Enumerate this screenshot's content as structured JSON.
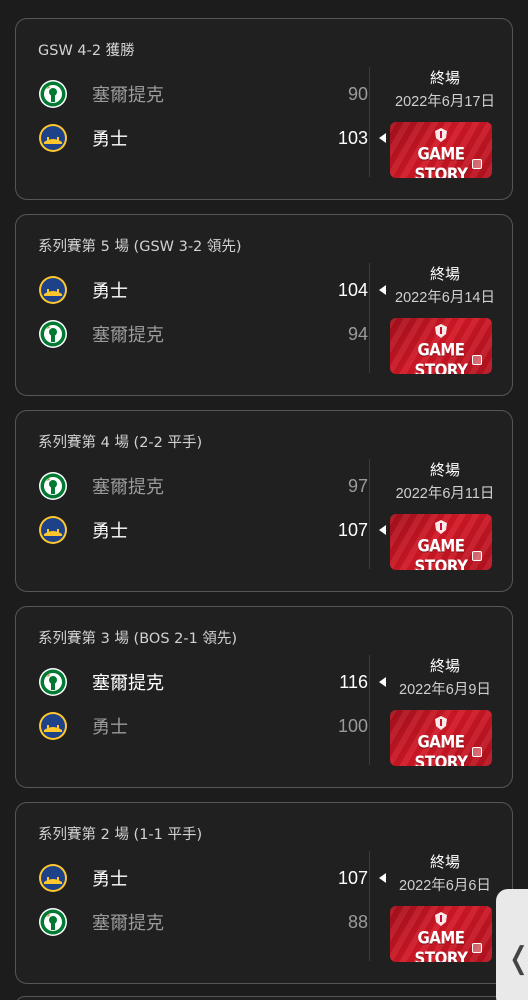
{
  "colors": {
    "background": "#1c1c1c",
    "card_border": "#555555",
    "gamestory_red": "#d41826",
    "warriors_blue": "#1d428a",
    "warriors_gold": "#ffc72c",
    "celtics_green": "#007a33"
  },
  "games": [
    {
      "title": "GSW 4-2 獲勝",
      "status": "終場",
      "date": "2022年6月17日",
      "gamestory_label": "GAME STORY",
      "teams": [
        {
          "name": "塞爾提克",
          "logo": "celtics-logo",
          "score": "90",
          "winner": false
        },
        {
          "name": "勇士",
          "logo": "warriors-logo",
          "score": "103",
          "winner": true
        }
      ]
    },
    {
      "title": "系列賽第 5 場 (GSW 3-2 領先)",
      "status": "終場",
      "date": "2022年6月14日",
      "gamestory_label": "GAME STORY",
      "teams": [
        {
          "name": "勇士",
          "logo": "warriors-logo",
          "score": "104",
          "winner": true
        },
        {
          "name": "塞爾提克",
          "logo": "celtics-logo",
          "score": "94",
          "winner": false
        }
      ]
    },
    {
      "title": "系列賽第 4 場 (2-2 平手)",
      "status": "終場",
      "date": "2022年6月11日",
      "gamestory_label": "GAME STORY",
      "teams": [
        {
          "name": "塞爾提克",
          "logo": "celtics-logo",
          "score": "97",
          "winner": false
        },
        {
          "name": "勇士",
          "logo": "warriors-logo",
          "score": "107",
          "winner": true
        }
      ]
    },
    {
      "title": "系列賽第 3 場 (BOS 2-1 領先)",
      "status": "終場",
      "date": "2022年6月9日",
      "gamestory_label": "GAME STORY",
      "teams": [
        {
          "name": "塞爾提克",
          "logo": "celtics-logo",
          "score": "116",
          "winner": true
        },
        {
          "name": "勇士",
          "logo": "warriors-logo",
          "score": "100",
          "winner": false
        }
      ]
    },
    {
      "title": "系列賽第 2 場 (1-1 平手)",
      "status": "終場",
      "date": "2022年6月6日",
      "gamestory_label": "GAME STORY",
      "teams": [
        {
          "name": "勇士",
          "logo": "warriors-logo",
          "score": "107",
          "winner": true
        },
        {
          "name": "塞爾提克",
          "logo": "celtics-logo",
          "score": "88",
          "winner": false
        }
      ]
    }
  ],
  "side_tab": {
    "icon": "chevron-left-icon",
    "glyph": "❬"
  }
}
